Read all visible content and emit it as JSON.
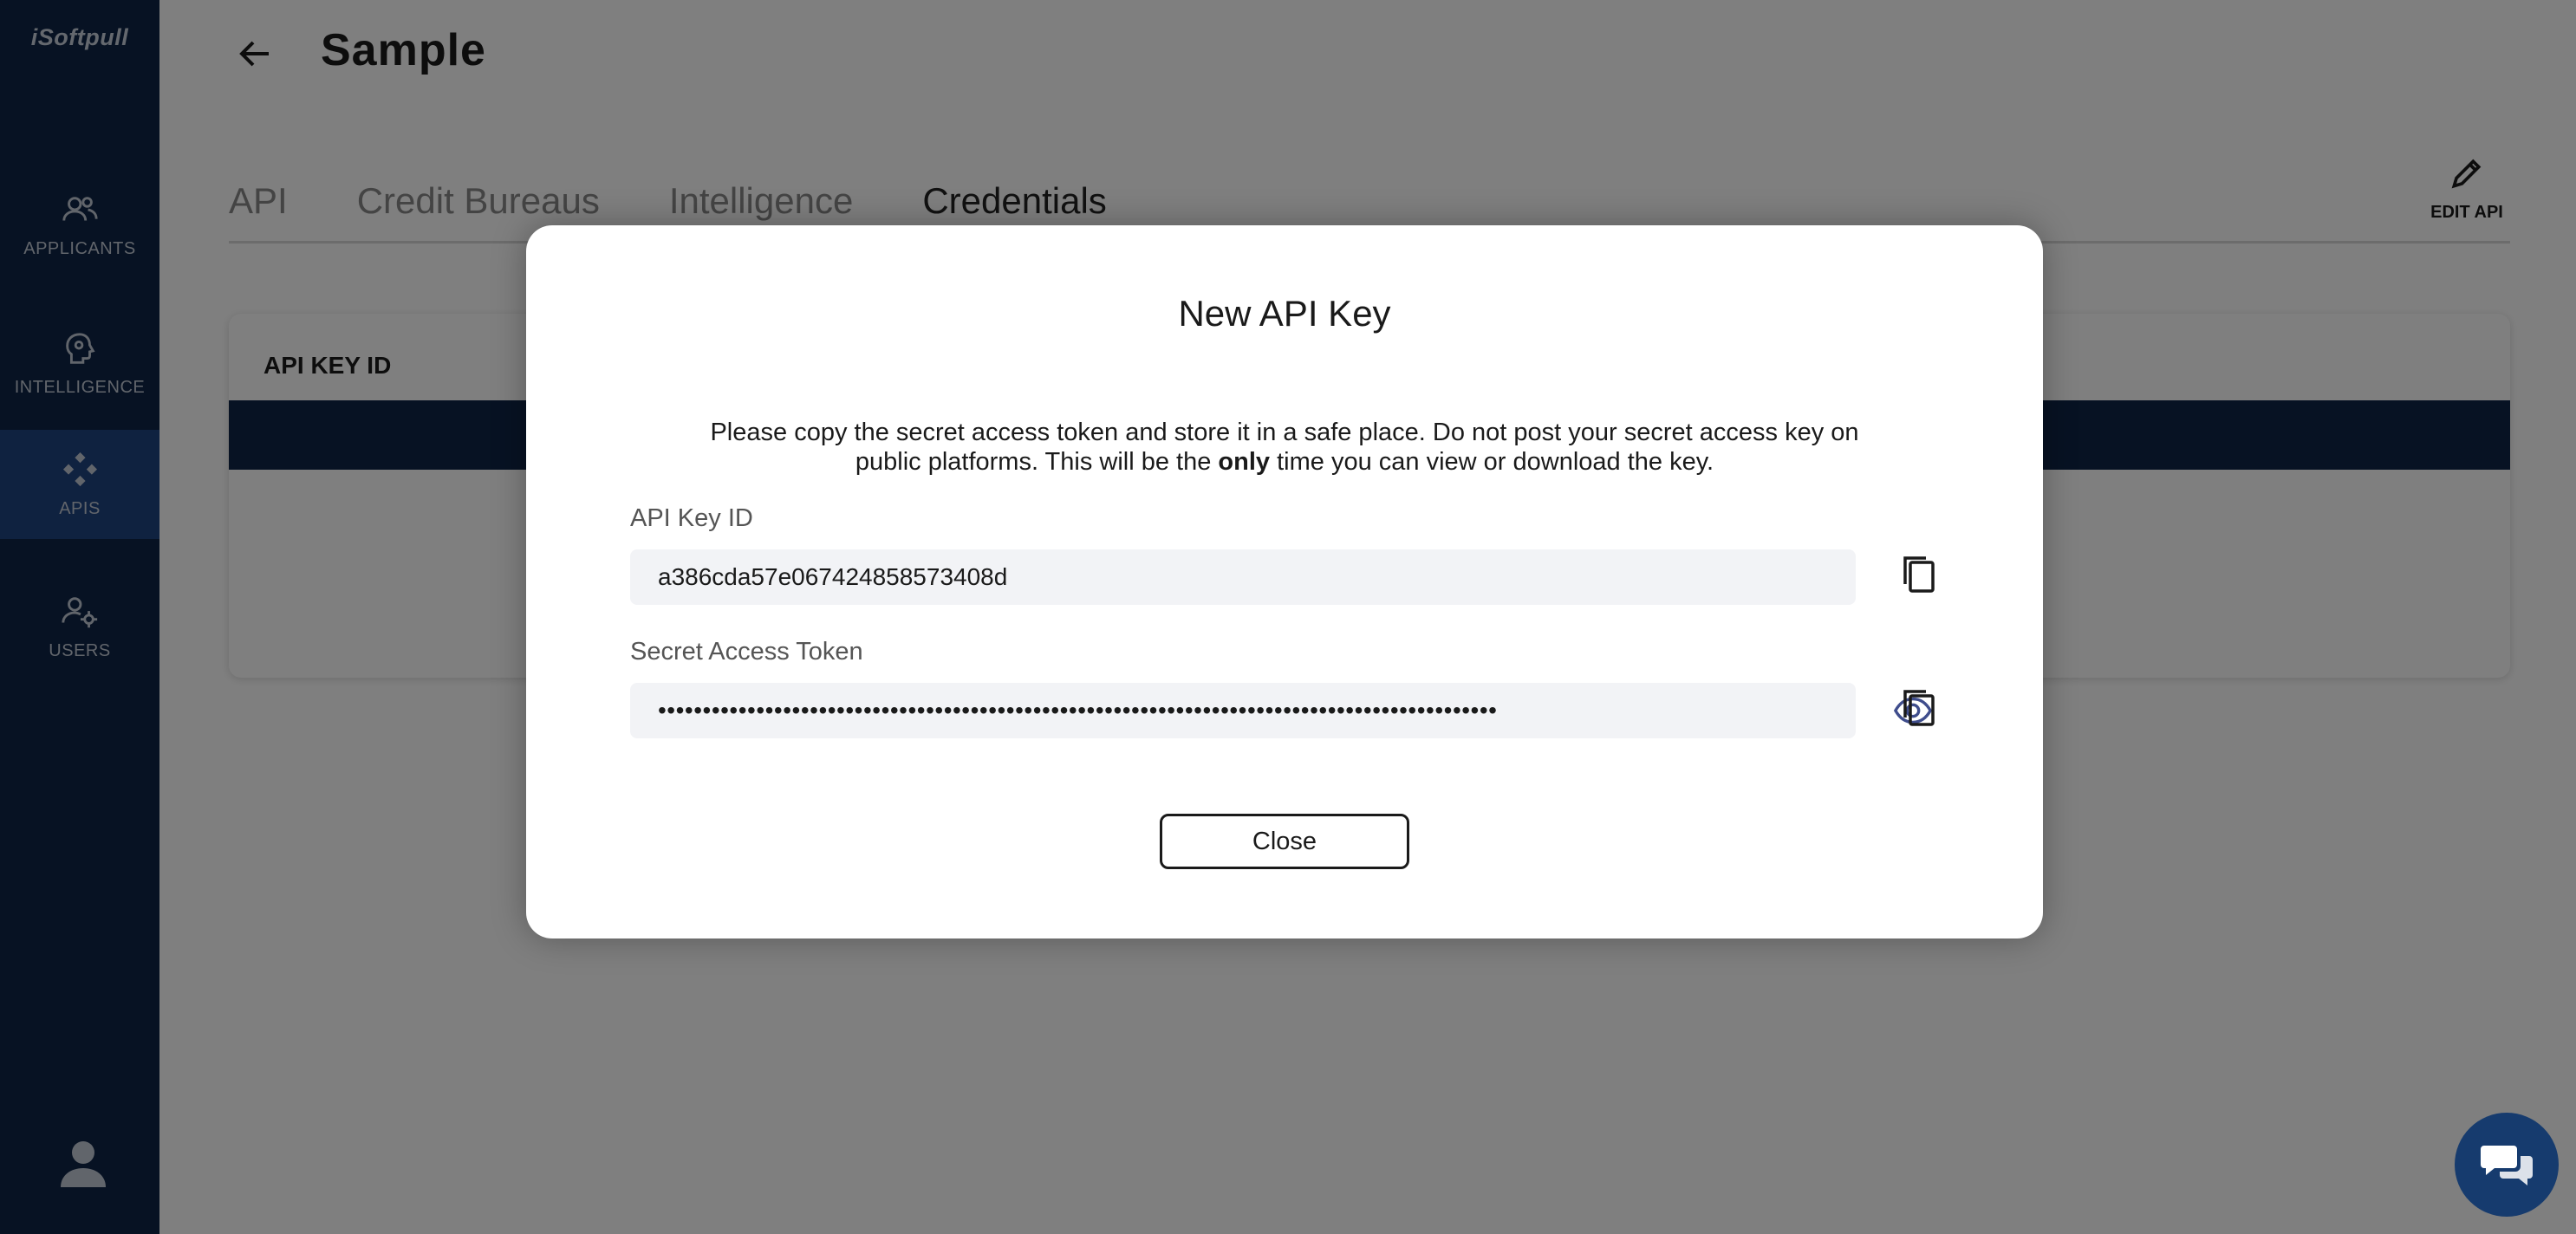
{
  "app": {
    "logo": "iSoftpull"
  },
  "sidebar": {
    "items": [
      {
        "label": "APPLICANTS",
        "icon": "applicants-icon"
      },
      {
        "label": "INTELLIGENCE",
        "icon": "intelligence-icon"
      },
      {
        "label": "APIS",
        "icon": "apis-icon",
        "active": true
      },
      {
        "label": "USERS",
        "icon": "users-icon"
      }
    ],
    "profile_icon": "profile-icon"
  },
  "header": {
    "title": "Sample"
  },
  "tabs": [
    {
      "label": "API"
    },
    {
      "label": "Credit Bureaus"
    },
    {
      "label": "Intelligence"
    },
    {
      "label": "Credentials",
      "active": true
    }
  ],
  "edit_api": {
    "label": "EDIT API"
  },
  "card": {
    "header": "API KEY ID"
  },
  "modal": {
    "title": "New API Key",
    "description_part1": "Please copy the secret access token and store it in a safe place. Do not post your secret access key on public platforms. This will be the ",
    "description_bold": "only",
    "description_part2": " time you can view or download the key.",
    "api_key_label": "API Key ID",
    "api_key_value": "a386cda57e067424858573408d",
    "secret_label": "Secret Access Token",
    "secret_value": "••••••••••••••••••••••••••••••••••••••••••••••••••••••••••••••••••••••••••••••••••••••••••••••",
    "close_label": "Close"
  },
  "colors": {
    "sidebar_bg": "#0f2547",
    "sidebar_active": "#1f4480",
    "chat_bubble": "#163b6e"
  }
}
